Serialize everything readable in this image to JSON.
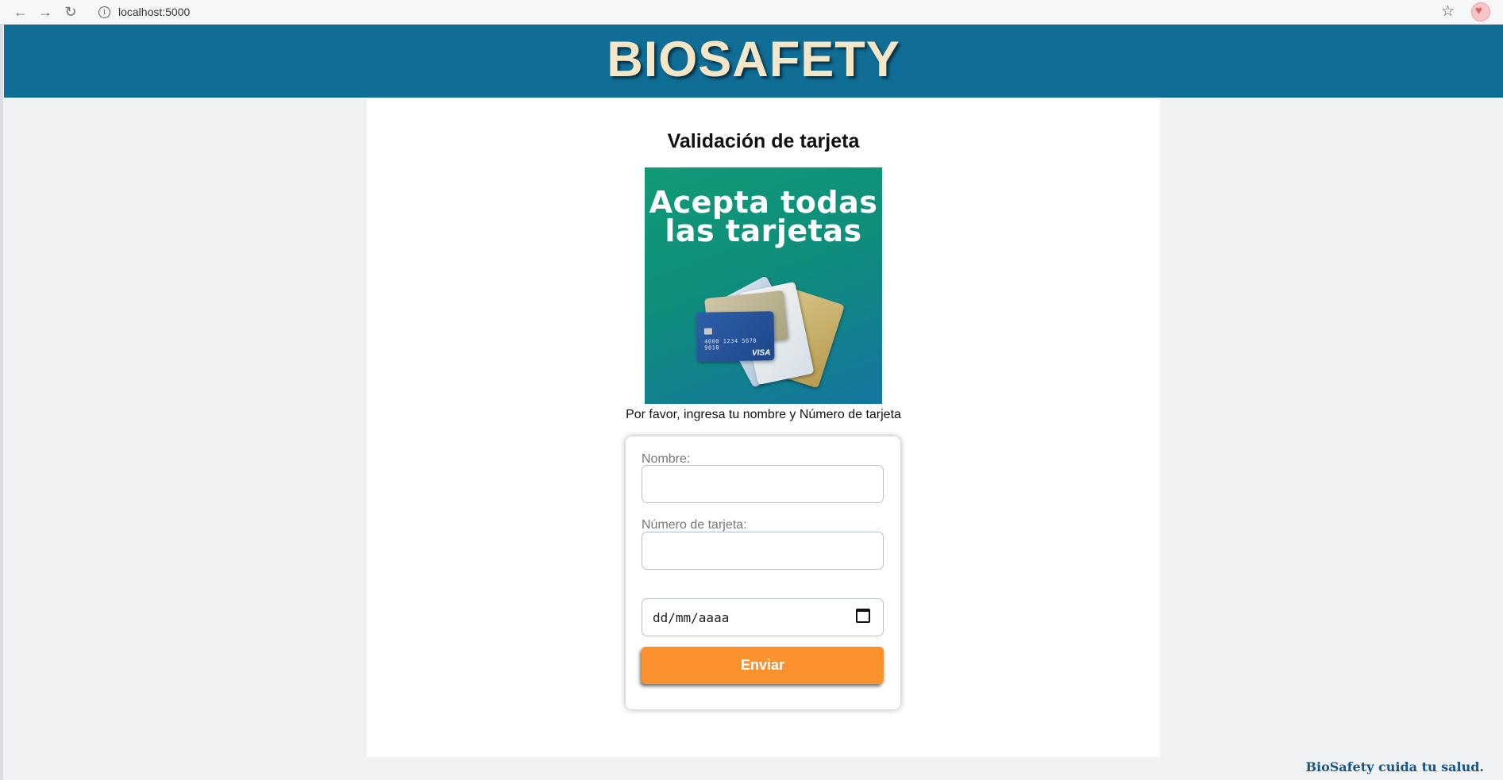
{
  "browser": {
    "url": "localhost:5000",
    "back_icon": "←",
    "forward_icon": "→",
    "reload_icon": "↻",
    "star_icon": "☆"
  },
  "header": {
    "site_title": "BIOSAFETY"
  },
  "main": {
    "page_title": "Validación de tarjeta",
    "promo": {
      "headline_line1": "Acepta todas",
      "headline_line2": "las tarjetas",
      "visa_label": "VISA",
      "card_number": "4000 1234 5678 9010"
    },
    "instructions": "Por favor, ingresa tu nombre y Número de tarjeta"
  },
  "form": {
    "name_label": "Nombre:",
    "name_value": "",
    "card_number_label": "Número de tarjeta:",
    "card_number_value": "",
    "date_placeholder": "dd/mm/aaaa",
    "submit_label": "Enviar"
  },
  "footer": {
    "slogan": "BioSafety cuida tu salud."
  },
  "colors": {
    "header_bg": "#0f6d96",
    "title_text": "#f5e6c8",
    "button_bg": "#fb922d",
    "slogan_text": "#17548a"
  }
}
